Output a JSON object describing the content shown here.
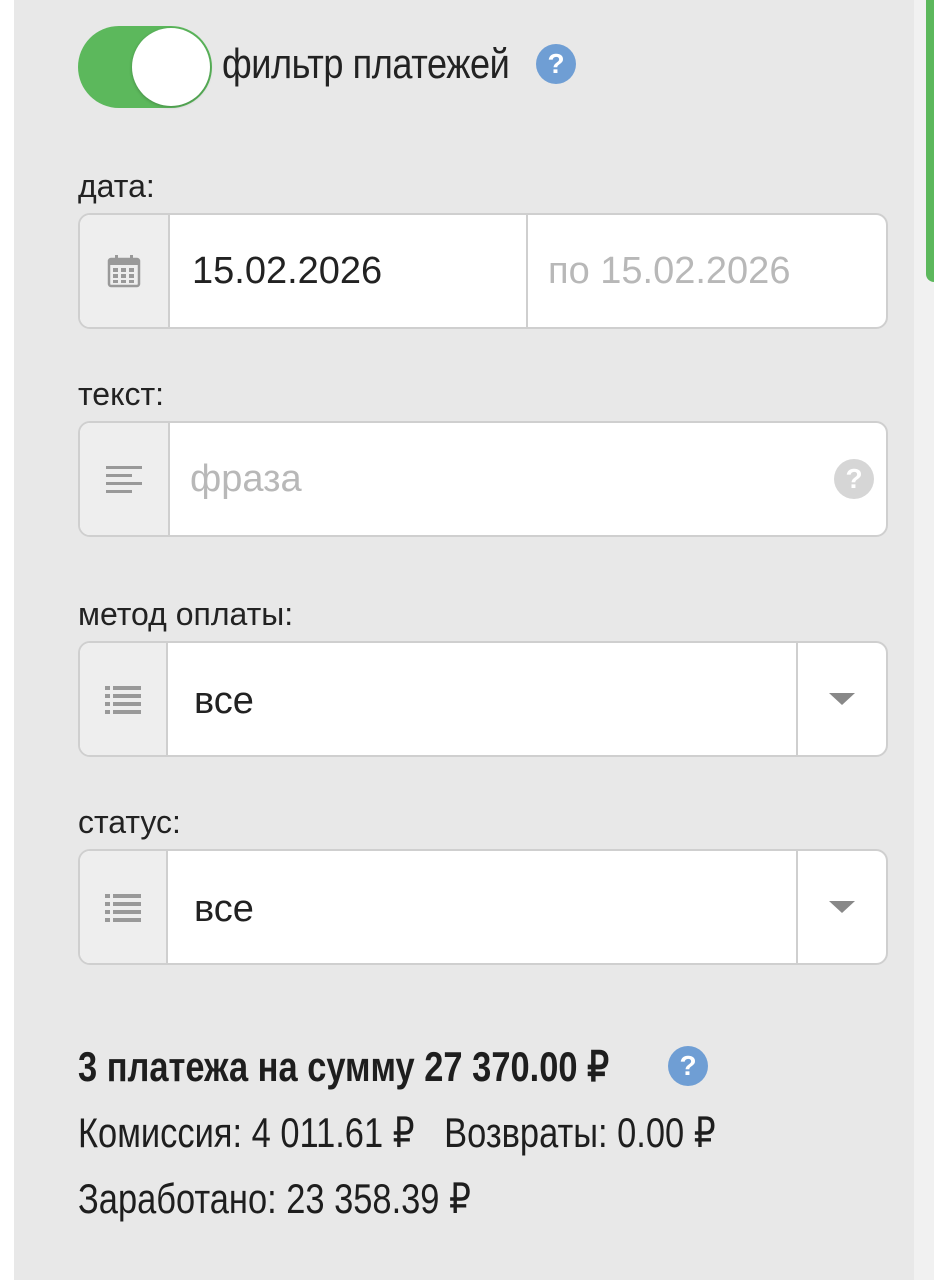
{
  "filter": {
    "title": "фильтр платежей",
    "enabled": true,
    "help": "?"
  },
  "date": {
    "label": "дата:",
    "from": "15.02.2026",
    "to_placeholder": "по 15.02.2026"
  },
  "text": {
    "label": "текст:",
    "placeholder": "фраза",
    "help": "?"
  },
  "payment_method": {
    "label": "метод оплаты:",
    "selected": "все"
  },
  "status": {
    "label": "статус:",
    "selected": "все"
  },
  "summary": {
    "total": "3 платежа на сумму 27 370.00 ₽",
    "help": "?",
    "commission": "Комиссия: 4 011.61 ₽",
    "refunds": "Возвраты: 0.00 ₽",
    "earned": "Заработано: 23 358.39 ₽"
  },
  "colors": {
    "toggle_on": "#5cb85c",
    "help_blue": "#6f9ed4",
    "panel_bg": "#e8e8e8"
  }
}
